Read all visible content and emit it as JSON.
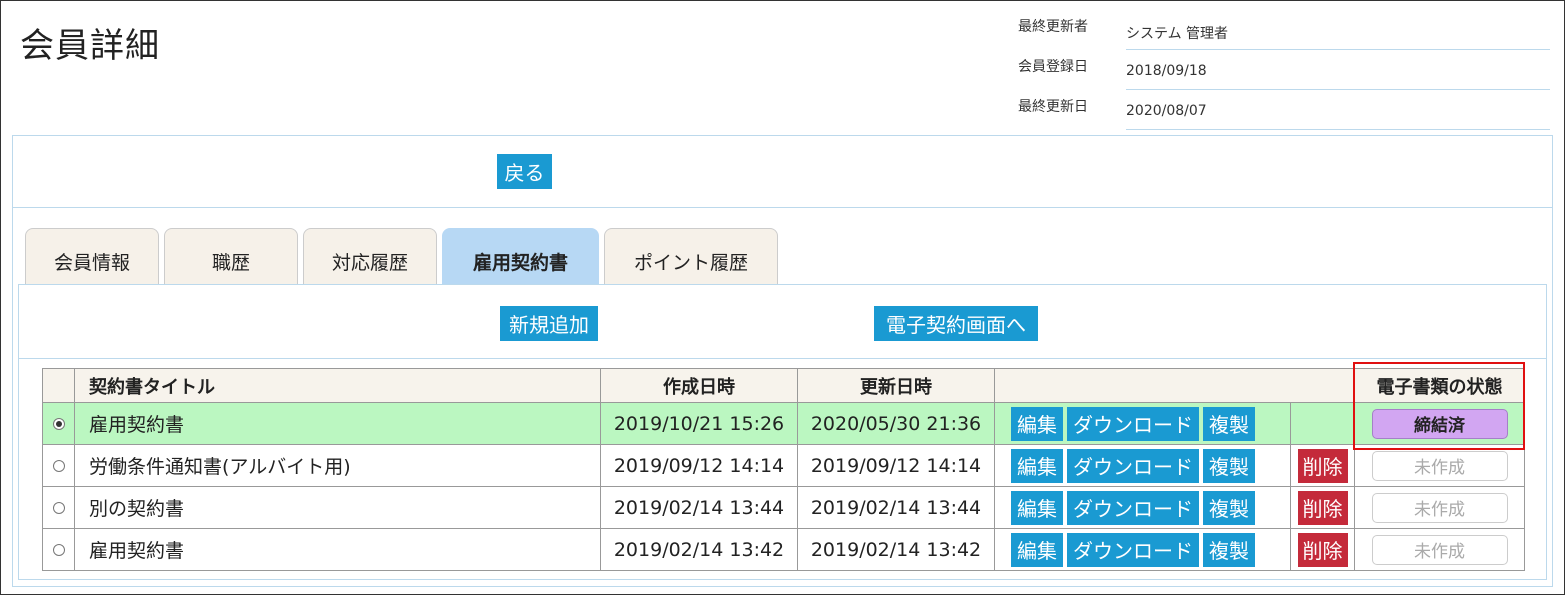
{
  "page": {
    "title": "会員詳細"
  },
  "meta": [
    {
      "label": "最終更新者",
      "value": "システム 管理者"
    },
    {
      "label": "会員登録日",
      "value": "2018/09/18"
    },
    {
      "label": "最終更新日",
      "value": "2020/08/07"
    }
  ],
  "back_label": "戻る",
  "tabs": [
    {
      "label": "会員情報"
    },
    {
      "label": "職歴"
    },
    {
      "label": "対応履歴"
    },
    {
      "label": "雇用契約書"
    },
    {
      "label": "ポイント履歴"
    }
  ],
  "active_tab_index": 3,
  "actions": {
    "new_label": "新規追加",
    "esign_label": "電子契約画面へ"
  },
  "table": {
    "headers": {
      "title": "契約書タイトル",
      "created": "作成日時",
      "updated": "更新日時",
      "status": "電子書類の状態"
    },
    "buttons": {
      "edit": "編集",
      "download": "ダウンロード",
      "copy": "複製",
      "delete": "削除"
    },
    "rows": [
      {
        "title": "雇用契約書",
        "created": "2019/10/21 15:26",
        "updated": "2020/05/30 21:36",
        "status": "締結済"
      },
      {
        "title": "労働条件通知書(アルバイト用)",
        "created": "2019/09/12 14:14",
        "updated": "2019/09/12 14:14",
        "status": "未作成"
      },
      {
        "title": "別の契約書",
        "created": "2019/02/14 13:44",
        "updated": "2019/02/14 13:44",
        "status": "未作成"
      },
      {
        "title": "雇用契約書",
        "created": "2019/02/14 13:42",
        "updated": "2019/02/14 13:42",
        "status": "未作成"
      }
    ]
  },
  "colors": {
    "accent": "#1a9ad2",
    "danger": "#c42a3a",
    "selected_row": "#bbf7c1",
    "status_done": "#d2a6f2",
    "highlight": "#e01010"
  }
}
